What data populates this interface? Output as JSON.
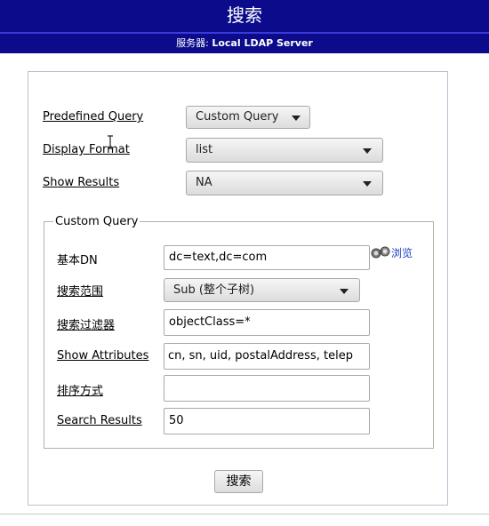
{
  "header": {
    "title": "搜索",
    "server_prefix": "服务器: ",
    "server_name": "Local LDAP Server"
  },
  "form": {
    "predefined_query": {
      "label": "Predefined Query",
      "value": "Custom Query"
    },
    "display_format": {
      "label": "Display Format",
      "value": "list"
    },
    "show_results": {
      "label": "Show Results",
      "value": "NA"
    }
  },
  "custom_query": {
    "legend": "Custom Query",
    "base_dn": {
      "label": "基本DN",
      "value": "dc=text,dc=com"
    },
    "browse_label": "浏览",
    "search_scope": {
      "label": "搜索范围",
      "value": "Sub (整个子树)"
    },
    "search_filter": {
      "label": "搜索过滤器",
      "value": "objectClass=*"
    },
    "show_attributes": {
      "label": "Show Attributes",
      "value": "cn, sn, uid, postalAddress, telep"
    },
    "sort_by": {
      "label": "排序方式",
      "value": ""
    },
    "search_results": {
      "label": "Search Results",
      "value": "50"
    }
  },
  "submit_label": "搜索",
  "colors": {
    "header_bg": "#0b0b8c",
    "link": "#1a3fbf"
  },
  "icons": {
    "browse": "binoculars-icon",
    "cursor": "text-cursor-icon"
  }
}
